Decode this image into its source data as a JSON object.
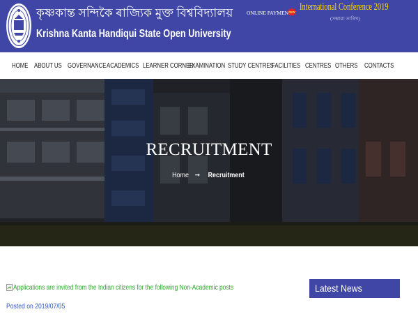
{
  "header": {
    "university_native": "কৃষ্ণকান্ত সন্দিকৈ ৰাজ্যিক মুক্ত বিশ্ববিদ্যালয়",
    "university_english": "Krishna Kanta Handiqui State Open University",
    "online_payment": "ONLINE PAYMENT",
    "new_badge": "NEW",
    "conference_title": "International Conference 2019",
    "conference_sub": "(সম্ভাৱ্য তাৰিখ)"
  },
  "nav": {
    "items": [
      "HOME",
      "ABOUT US",
      "GOVERNANCE",
      "ACADEMICS",
      "LEARNER CORNER",
      "EXAMINATION",
      "STUDY CENTRES",
      "FACILITIES",
      "CENTRES",
      "OTHERS",
      "CONTACTS"
    ]
  },
  "hero": {
    "title": "RECRUITMENT",
    "breadcrumb_home": "Home",
    "breadcrumb_sep": "➞",
    "breadcrumb_current": "Recruitment"
  },
  "content": {
    "notice_text": "Applications are invited from the Indian citizens for the following Non-Academic posts",
    "posted_on": "Posted on 2019/07/05"
  },
  "sidebar": {
    "latest_news": "Latest News"
  },
  "colors": {
    "brand_blue": "#3f46a6",
    "conference_yellow": "#ffd800",
    "notice_green": "#2fa52f",
    "posted_blue": "#2f55c4"
  },
  "icons": {
    "logo": "university-seal",
    "new_badge": "new-badge-icon",
    "notice": "broken-image-icon"
  }
}
